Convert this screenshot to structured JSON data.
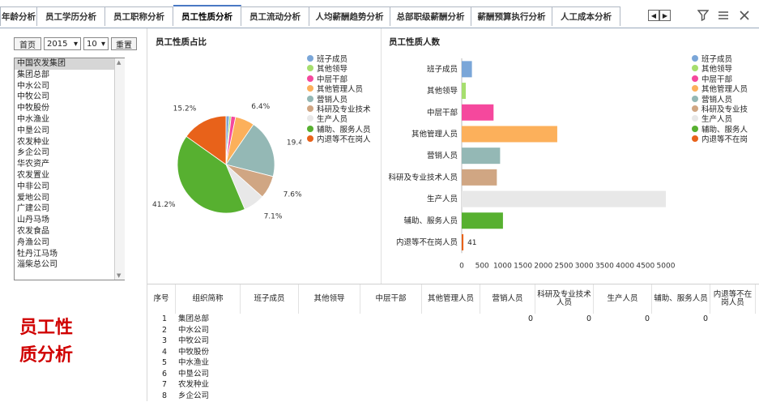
{
  "tabs": [
    "年龄分析",
    "员工学历分析",
    "员工职称分析",
    "员工性质分析",
    "员工流动分析",
    "人均薪酬趋势分析",
    "总部职级薪酬分析",
    "薪酬预算执行分析",
    "人工成本分析"
  ],
  "active_tab": "员工性质分析",
  "toolbar": {
    "prev": "◀",
    "next": "▶",
    "filter_icon": "filter-icon",
    "menu_icon": "menu-icon",
    "close_icon": "close-icon"
  },
  "controls": {
    "first_page": "首页",
    "year": "2015",
    "month": "10",
    "reset": "重置"
  },
  "org_list": [
    "中国农发集团",
    "集团总部",
    "中水公司",
    "中牧公司",
    "中牧股份",
    "中水渔业",
    "中垦公司",
    "农发种业",
    "乡企公司",
    "华农资产",
    "农发置业",
    "中非公司",
    "爱地公司",
    "广建公司",
    "山丹马场",
    "农发食品",
    "舟渔公司",
    "牡丹江马场",
    "淄柴总公司"
  ],
  "selected_org": "中国农发集团",
  "page_label": "员工性质分析",
  "pie_title": "员工性质占比",
  "bar_title": "员工性质人数",
  "legend": [
    "班子成员",
    "其他领导",
    "中层干部",
    "其他管理人员",
    "营销人员",
    "科研及专业技术",
    "生产人员",
    "辅助、服务人员",
    "内退等不在岗人"
  ],
  "legend_bar": [
    "班子成员",
    "其他领导",
    "中层干部",
    "其他管理人员",
    "营销人员",
    "科研及专业技",
    "生产人员",
    "辅助、服务人",
    "内退等不在岗"
  ],
  "colors": [
    "#7aa6d8",
    "#a6de6e",
    "#f5489d",
    "#fcb05b",
    "#94b8b5",
    "#d0a683",
    "#e8e8e8",
    "#57b030",
    "#e8621a"
  ],
  "chart_data": [
    {
      "type": "pie",
      "title": "员工性质占比",
      "categories": [
        "班子成员",
        "其他领导",
        "中层干部",
        "其他管理人员",
        "营销人员",
        "科研及专业技术人员",
        "生产人员",
        "辅助、服务人员",
        "内退等不在岗人员"
      ],
      "values": [
        1.1,
        0.6,
        1.5,
        6.4,
        19.4,
        7.6,
        7.1,
        41.2,
        15.2
      ],
      "labels": [
        "15.2%",
        "6.4%",
        "19.4%",
        "7.6%",
        "7.1%",
        "41.2%"
      ]
    },
    {
      "type": "bar",
      "title": "员工性质人数",
      "categories": [
        "班子成员",
        "其他领导",
        "中层干部",
        "其他管理人员",
        "营销人员",
        "科研及专业技术人员",
        "生产人员",
        "辅助、服务人员",
        "内退等不在岗人员"
      ],
      "values": [
        250,
        100,
        780,
        2340,
        940,
        860,
        5000,
        1010,
        41
      ],
      "value_labels": [
        "",
        "",
        "",
        "",
        "",
        "",
        "",
        "",
        "41"
      ],
      "xlim": [
        0,
        5000
      ],
      "xticks": [
        "0",
        "500",
        "1000",
        "1500",
        "2000",
        "2500",
        "3000",
        "3500",
        "4000",
        "4500",
        "5000"
      ]
    }
  ],
  "table": {
    "headers": [
      "序号",
      "组织简称",
      "班子成员",
      "其他领导",
      "中层干部",
      "其他管理人员",
      "营销人员",
      "科研及专业技术人员",
      "生产人员",
      "辅助、服务人员",
      "内退等不在岗人员"
    ],
    "rows": [
      [
        "1",
        "集团总部",
        "",
        "",
        "",
        "",
        "0",
        "0",
        "0",
        "0",
        ""
      ],
      [
        "2",
        "中水公司",
        "",
        "",
        "",
        "",
        "",
        "",
        "",
        "",
        ""
      ],
      [
        "3",
        "中牧公司",
        "",
        "",
        "",
        "",
        "",
        "",
        "",
        "",
        ""
      ],
      [
        "4",
        "中牧股份",
        "",
        "",
        "",
        "",
        "",
        "",
        "",
        "",
        ""
      ],
      [
        "5",
        "中水渔业",
        "",
        "",
        "",
        "",
        "",
        "",
        "",
        "",
        ""
      ],
      [
        "6",
        "中垦公司",
        "",
        "",
        "",
        "",
        "",
        "",
        "",
        "",
        ""
      ],
      [
        "7",
        "农发种业",
        "",
        "",
        "",
        "",
        "",
        "",
        "",
        "",
        ""
      ],
      [
        "8",
        "乡企公司",
        "",
        "",
        "",
        "",
        "",
        "",
        "",
        "",
        ""
      ]
    ]
  }
}
